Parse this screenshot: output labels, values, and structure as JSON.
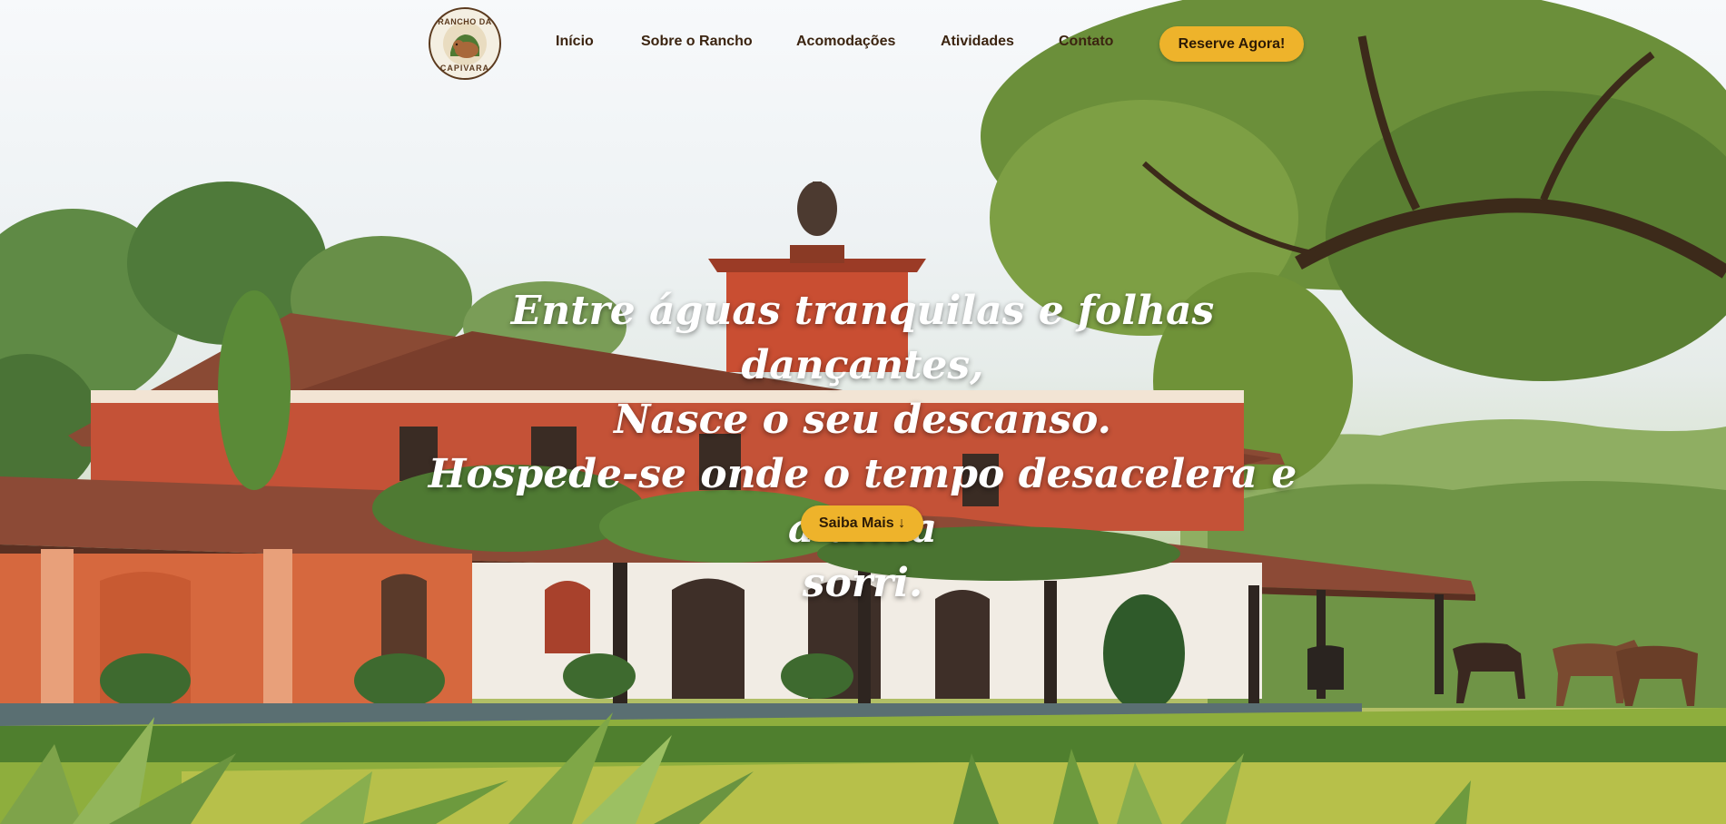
{
  "brand": {
    "logo_top": "RANCHO DA",
    "logo_bottom": "CAPIVARA"
  },
  "nav": {
    "items": [
      {
        "label": "Início"
      },
      {
        "label": "Sobre o Rancho"
      },
      {
        "label": "Acomodações"
      },
      {
        "label": "Atividades"
      },
      {
        "label": "Contato"
      }
    ],
    "cta_label": "Reserve Agora!"
  },
  "hero": {
    "lines": [
      "Entre águas tranquilas e folhas dançantes,",
      "Nasce o seu descanso.",
      "Hospede-se onde o tempo desacelera e a alma",
      "sorri."
    ],
    "button_label": "Saiba Mais ↓"
  },
  "colors": {
    "accent": "#eeb32b",
    "nav_text": "#3b2410",
    "headline": "#ffffff"
  }
}
